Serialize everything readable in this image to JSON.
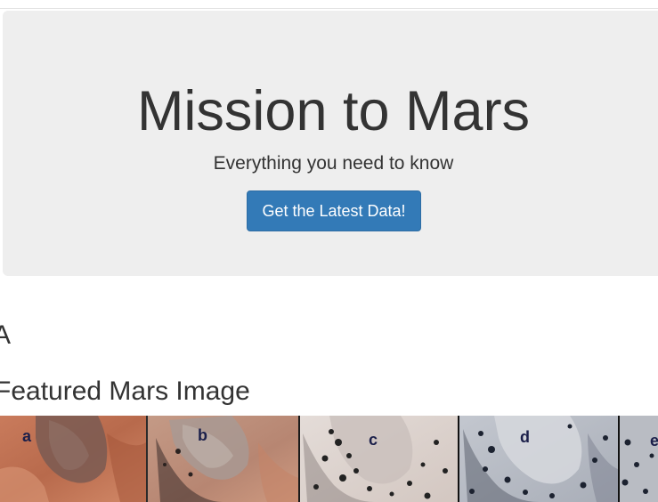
{
  "jumbotron": {
    "title": "Mission to Mars",
    "subtitle": "Everything you need to know",
    "button_label": "Get the Latest Data!"
  },
  "news": {
    "heading": "A"
  },
  "featured": {
    "heading": "Featured Mars Image",
    "panel_labels": [
      "a",
      "b",
      "c",
      "d",
      "e"
    ]
  },
  "colors": {
    "jumbotron_bg": "#eeeeee",
    "button_bg": "#337ab7",
    "text": "#333333"
  }
}
